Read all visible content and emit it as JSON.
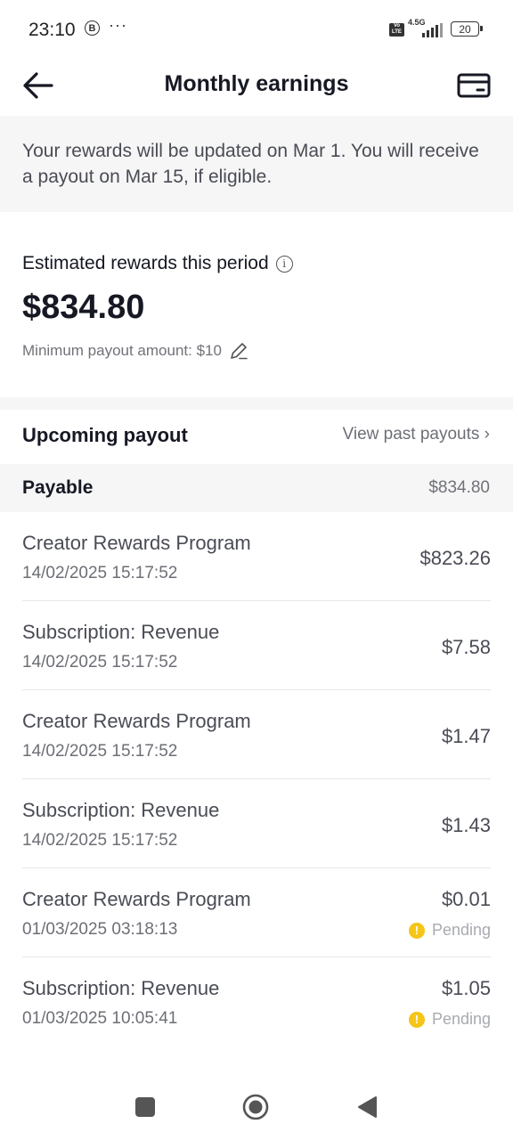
{
  "status_bar": {
    "time": "23:10",
    "b_badge": "B",
    "dots": "···",
    "volte": "Vo LTE",
    "network": "4.5G",
    "battery": "20"
  },
  "header": {
    "title": "Monthly earnings",
    "back_icon": "arrow-left-icon",
    "wallet_icon": "wallet-icon"
  },
  "banner": {
    "text": "Your rewards will be updated on Mar 1. You will receive a payout on Mar 15, if eligible."
  },
  "estimate": {
    "label": "Estimated rewards this period",
    "info_glyph": "i",
    "amount": "$834.80",
    "min_payout": "Minimum payout amount: $10"
  },
  "payout": {
    "title": "Upcoming payout",
    "past_link": "View past payouts ›"
  },
  "payable": {
    "label": "Payable",
    "amount": "$834.80"
  },
  "rows": [
    {
      "name": "Creator Rewards Program",
      "date": "14/02/2025 15:17:52",
      "amount": "$823.26",
      "status": ""
    },
    {
      "name": "Subscription: Revenue",
      "date": "14/02/2025 15:17:52",
      "amount": "$7.58",
      "status": ""
    },
    {
      "name": "Creator Rewards Program",
      "date": "14/02/2025 15:17:52",
      "amount": "$1.47",
      "status": ""
    },
    {
      "name": "Subscription: Revenue",
      "date": "14/02/2025 15:17:52",
      "amount": "$1.43",
      "status": ""
    },
    {
      "name": "Creator Rewards Program",
      "date": "01/03/2025 03:18:13",
      "amount": "$0.01",
      "status": "Pending"
    },
    {
      "name": "Subscription: Revenue",
      "date": "01/03/2025 10:05:41",
      "amount": "$1.05",
      "status": "Pending"
    }
  ],
  "pending_icon_glyph": "!",
  "colors": {
    "accent_text": "#161823",
    "pending_icon": "#f5c518",
    "band_bg": "#f6f6f6"
  }
}
